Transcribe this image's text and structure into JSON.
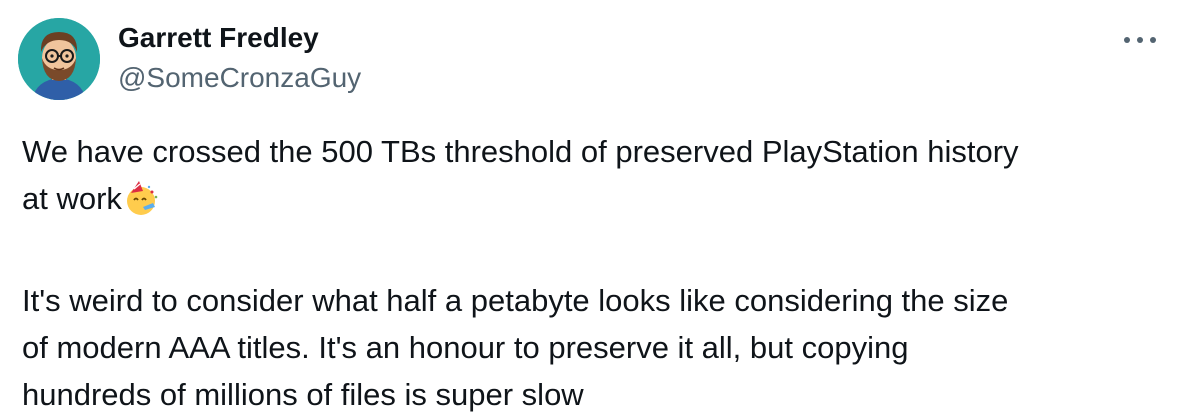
{
  "author": {
    "display_name": "Garrett Fredley",
    "handle": "@SomeCronzaGuy",
    "avatar_icon": "cartoon-avatar-icon",
    "avatar_bg": "#27a6a4"
  },
  "menu": {
    "icon": "more-icon"
  },
  "tweet": {
    "para1_line1": "We have crossed the 500 TBs threshold of preserved PlayStation history",
    "para1_line2": "at work",
    "emoji": "partying-face-icon",
    "para2_line1": "It's weird to consider what half a petabyte looks like considering the size",
    "para2_line2": "of modern AAA titles. It's an honour to preserve it all, but copying",
    "para2_line3": "hundreds of millions of files is super slow"
  },
  "colors": {
    "text_primary": "#0f1419",
    "text_secondary": "#536471"
  }
}
